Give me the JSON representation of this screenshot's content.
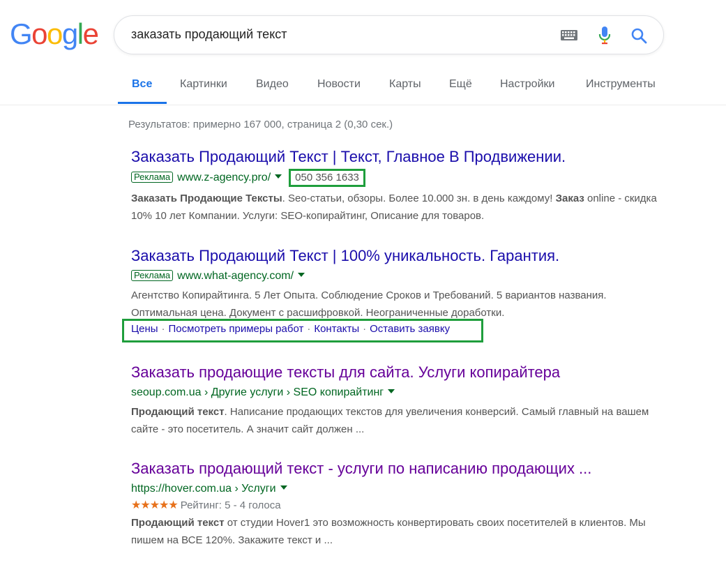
{
  "logo": {
    "letters": [
      "G",
      "o",
      "o",
      "g",
      "l",
      "e"
    ],
    "colors": [
      "#4285F4",
      "#EA4335",
      "#FBBC05",
      "#4285F4",
      "#34A853",
      "#EA4335"
    ]
  },
  "search": {
    "query": "заказать продающий текст"
  },
  "tabs": [
    "Все",
    "Картинки",
    "Видео",
    "Новости",
    "Карты",
    "Ещё",
    "Настройки",
    "Инструменты"
  ],
  "stats": "Результатов: примерно 167 000, страница 2 (0,30 сек.)",
  "results": [
    {
      "title": "Заказать Продающий Текст | Текст, Главное В Продвижении.",
      "badge": "Реклама",
      "url": "www.z-agency.pro/",
      "phone": "050 356 1633",
      "snippet_parts": [
        [
          "Заказать Продающие Тексты",
          true
        ],
        [
          ". Seo-статьи, обзоры. Более 10.000 зн. в день каждому! ",
          false
        ],
        [
          "Заказ",
          true
        ],
        [
          " online - скидка 10% 10 лет Компании. Услуги: SEO-копирайтинг, Описание для товаров.",
          false
        ]
      ]
    },
    {
      "title": "Заказать Продающий Текст | 100% уникальность. Гарантия.",
      "badge": "Реклама",
      "url": "www.what-agency.com/",
      "snippet_parts": [
        [
          "Агентство Копирайтинга. 5 Лет Опыта. Соблюдение Сроков и Требований. 5 вариантов названия. Оптимальная цена. Документ с расшифровкой. Неограниченные доработки.",
          false
        ]
      ],
      "sitelinks": [
        "Цены",
        "Посмотреть примеры работ",
        "Контакты",
        "Оставить заявку"
      ]
    },
    {
      "title": "Заказать продающие тексты для сайта. Услуги копирайтера",
      "url": "seoup.com.ua › Другие услуги › SEO копирайтинг",
      "snippet_parts": [
        [
          "Продающий текст",
          true
        ],
        [
          ". Написание продающих текстов для увеличения конверсий. Самый главный на вашем сайте - это посетитель. А значит сайт должен ...",
          false
        ]
      ]
    },
    {
      "title": "Заказать продающий текст - услуги по написанию продающих ...",
      "url": "https://hover.com.ua › Услуги",
      "stars": "★★★★★",
      "rating": "Рейтинг: 5 - 4 голоса",
      "rating_value": 5,
      "snippet_parts": [
        [
          "Продающий текст",
          true
        ],
        [
          " от студии Hover1 это возможность конвертировать своих посетителей в клиентов. Мы пишем на ВСЕ 120%. Закажите текст и ...",
          false
        ]
      ]
    }
  ]
}
